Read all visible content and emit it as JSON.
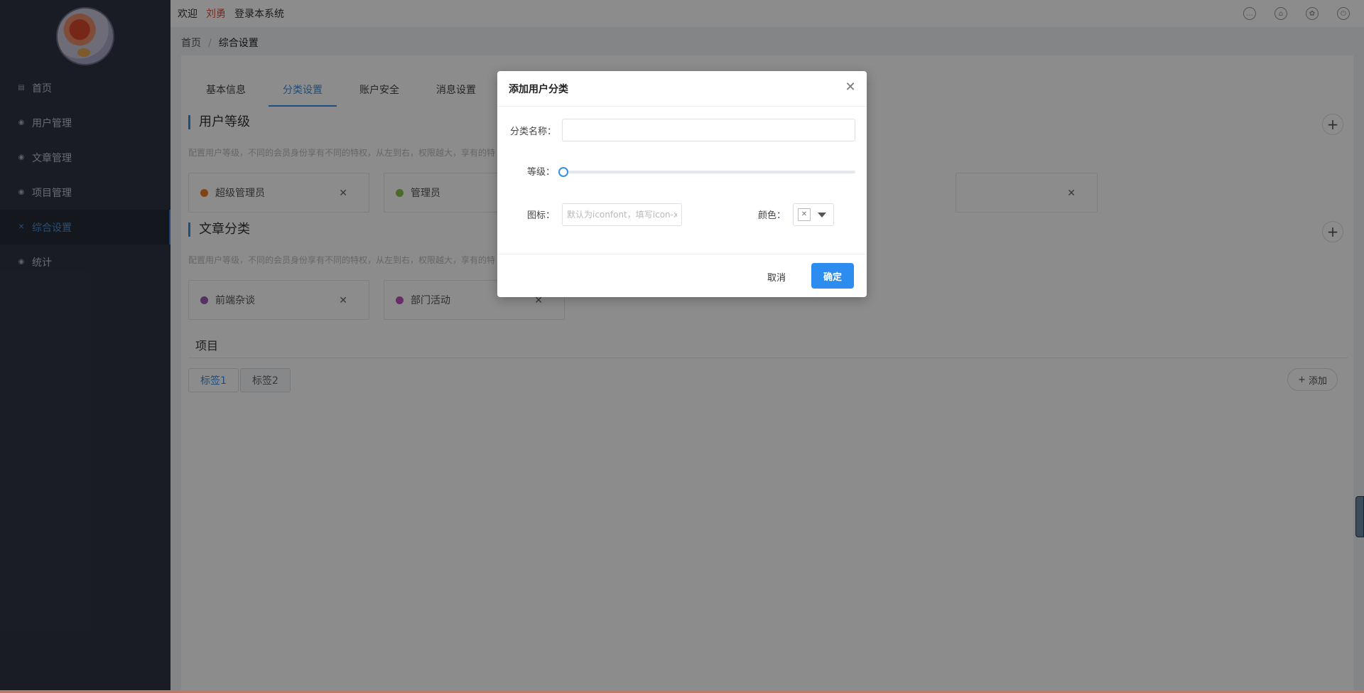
{
  "sidebar": {
    "items": [
      {
        "label": "首页",
        "icon": "home-icon"
      },
      {
        "label": "用户管理",
        "icon": "eye-icon"
      },
      {
        "label": "文章管理",
        "icon": "eye-icon"
      },
      {
        "label": "项目管理",
        "icon": "eye-icon"
      },
      {
        "label": "综合设置",
        "icon": "tools-icon"
      },
      {
        "label": "统计",
        "icon": "eye-icon"
      }
    ]
  },
  "topbar": {
    "welcome": "欢迎",
    "username": "刘勇",
    "suffix": "登录本系统"
  },
  "breadcrumb": {
    "home": "首页",
    "current": "综合设置"
  },
  "tabs": [
    "基本信息",
    "分类设置",
    "账户安全",
    "消息设置"
  ],
  "sections": {
    "user_level": {
      "title": "用户等级",
      "desc": "配置用户等级，不同的会员身份享有不同的特权，从左到右，权限越大，享有的特",
      "cards": [
        {
          "label": "超级管理员",
          "color": "#e67e22"
        },
        {
          "label": "管理员",
          "color": "#8bc34a"
        }
      ]
    },
    "article_category": {
      "title": "文章分类",
      "desc": "配置用户等级，不同的会员身份享有不同的特权，从左到右，权限越大，享有的特",
      "cards": [
        {
          "label": "前端杂谈",
          "color": "#9b59b6"
        },
        {
          "label": "部门活动",
          "color": "#c04fc0"
        }
      ]
    },
    "project": {
      "title": "项目",
      "tags": [
        "标签1",
        "标签2"
      ],
      "add_label": "添加"
    }
  },
  "modal": {
    "title": "添加用户分类",
    "name_label": "分类名称：",
    "name_value": "",
    "level_label": "等级：",
    "level_value": 0,
    "icon_label": "图标：",
    "icon_placeholder": "默认为iconfont，填写icon-xxx",
    "color_label": "颜色：",
    "cancel_label": "取消",
    "ok_label": "确定"
  },
  "colors": {
    "accent": "#2d8cf0",
    "sidebar_bg": "#2f3443"
  }
}
